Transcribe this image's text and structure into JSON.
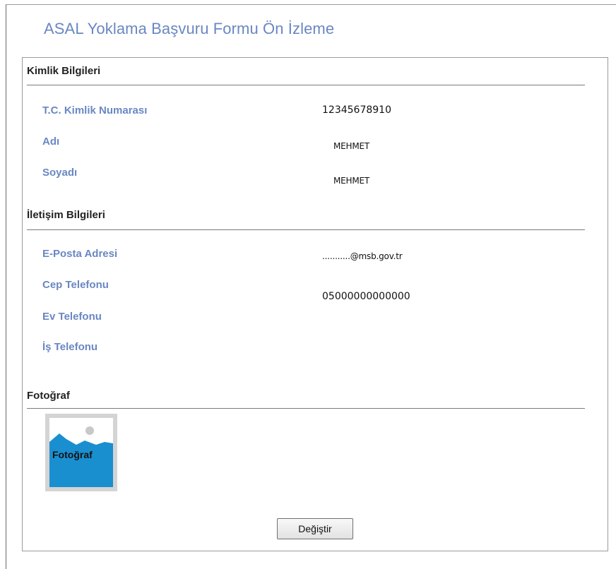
{
  "page": {
    "title": "ASAL Yoklama Başvuru Formu Ön İzleme"
  },
  "identity": {
    "section_title": "Kimlik Bilgileri",
    "tc_label": "T.C. Kimlik Numarası",
    "tc_value": "12345678910",
    "name_label": "Adı",
    "name_value": "MEHMET",
    "surname_label": "Soyadı",
    "surname_value": "MEHMET"
  },
  "contact": {
    "section_title": "İletişim Bilgileri",
    "email_label": "E-Posta Adresi",
    "email_value": "...........@msb.gov.tr",
    "mobile_label": "Cep Telefonu",
    "mobile_value": "05000000000000",
    "home_label": "Ev Telefonu",
    "work_label": "İş Telefonu"
  },
  "photo": {
    "section_title": "Fotoğraf",
    "placeholder_label": "Fotoğraf",
    "icon": "image-placeholder-icon",
    "colors": {
      "sky": "#1a8fd0",
      "frame": "#d4d4d4",
      "sun": "#c8c8c8"
    }
  },
  "actions": {
    "change_label": "Değiştir"
  },
  "colors": {
    "label_blue": "#6a87c2",
    "title_blue": "#6a87c2"
  }
}
